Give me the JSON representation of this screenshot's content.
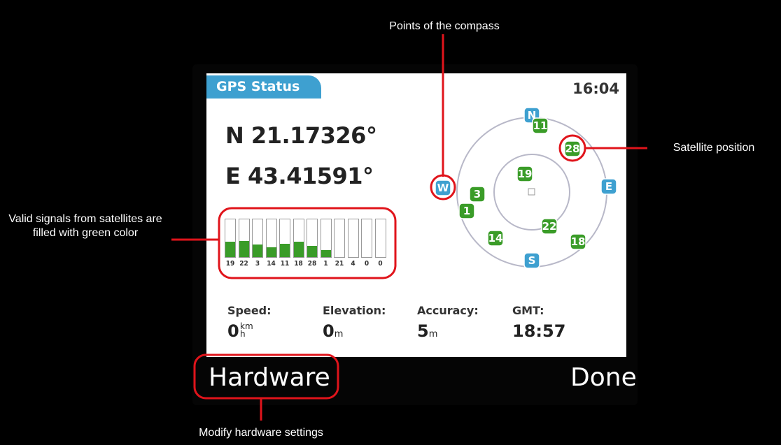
{
  "screen": {
    "title": "GPS Status",
    "time": "16:04",
    "latitude": "N 21.17326°",
    "longitude": "E 43.41591°"
  },
  "signal_bars": [
    {
      "label": "19",
      "level": 0.4
    },
    {
      "label": "22",
      "level": 0.42
    },
    {
      "label": "3",
      "level": 0.33
    },
    {
      "label": "14",
      "level": 0.26
    },
    {
      "label": "11",
      "level": 0.36
    },
    {
      "label": "18",
      "level": 0.4
    },
    {
      "label": "28",
      "level": 0.3
    },
    {
      "label": "1",
      "level": 0.18
    },
    {
      "label": "21",
      "level": 0
    },
    {
      "label": "4",
      "level": 0
    },
    {
      "label": "0",
      "level": 0
    },
    {
      "label": "0",
      "level": 0
    }
  ],
  "compass": [
    "N",
    "E",
    "S",
    "W"
  ],
  "satellites": [
    "11",
    "28",
    "19",
    "3",
    "1",
    "22",
    "14",
    "18"
  ],
  "stats": {
    "speed_label": "Speed:",
    "speed_value": "0",
    "speed_unit_top": "km",
    "speed_unit_bottom": "h",
    "elevation_label": "Elevation:",
    "elevation_value": "0",
    "elevation_unit": "m",
    "accuracy_label": "Accuracy:",
    "accuracy_value": "5",
    "accuracy_unit": "m",
    "gmt_label": "GMT:",
    "gmt_value": "18:57"
  },
  "softkeys": {
    "left": "Hardware",
    "right": "Done"
  },
  "callouts": {
    "compass": "Points of the compass",
    "satellite": "Satellite position",
    "signals": "Valid signals from satellites are filled with green color",
    "hardware": "Modify hardware settings"
  },
  "colors": {
    "accent": "#3ea0d0",
    "signal_green": "#3a9c28",
    "callout_red": "#e0141b"
  }
}
